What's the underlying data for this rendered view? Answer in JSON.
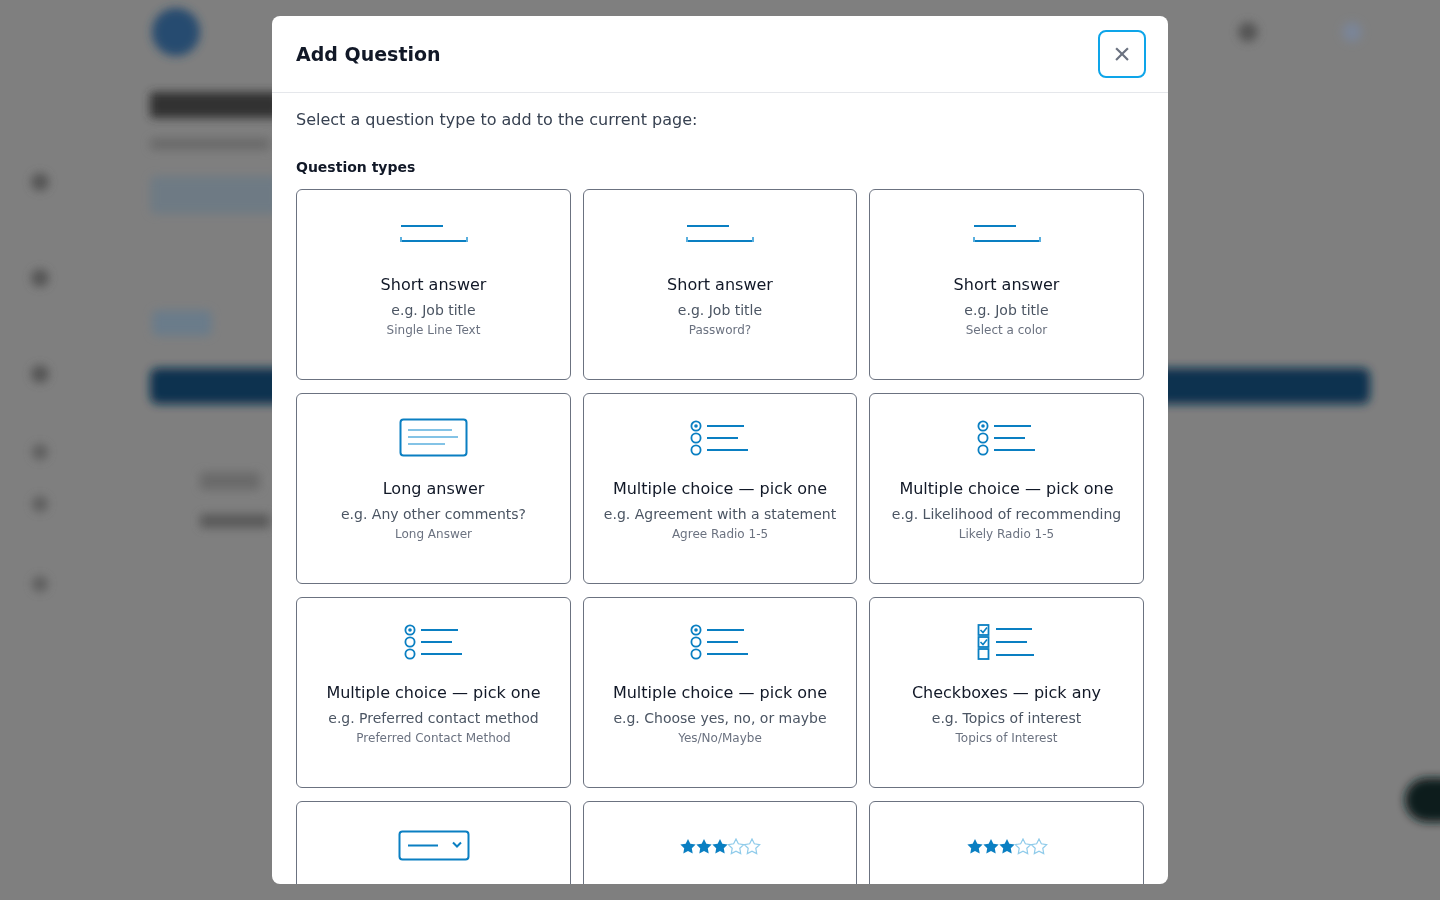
{
  "dialog": {
    "title": "Add Question",
    "close_label": "×",
    "intro": "Select a question type to add to the current page:",
    "section_label": "Question types",
    "question_types": [
      {
        "kind": "short",
        "title": "Short answer",
        "example": "e.g. Job title",
        "subtitle": "Single Line Text"
      },
      {
        "kind": "short",
        "title": "Short answer",
        "example": "e.g. Job title",
        "subtitle": "Password?"
      },
      {
        "kind": "short",
        "title": "Short answer",
        "example": "e.g. Job title",
        "subtitle": "Select a color"
      },
      {
        "kind": "long",
        "title": "Long answer",
        "example": "e.g. Any other comments?",
        "subtitle": "Long Answer"
      },
      {
        "kind": "radio",
        "title": "Multiple choice — pick one",
        "example": "e.g. Agreement with a statement",
        "subtitle": "Agree Radio 1-5"
      },
      {
        "kind": "radio",
        "title": "Multiple choice — pick one",
        "example": "e.g. Likelihood of recommending",
        "subtitle": "Likely Radio 1-5"
      },
      {
        "kind": "radio",
        "title": "Multiple choice — pick one",
        "example": "e.g. Preferred contact method",
        "subtitle": "Preferred Contact Method"
      },
      {
        "kind": "radio",
        "title": "Multiple choice — pick one",
        "example": "e.g. Choose yes, no, or maybe",
        "subtitle": "Yes/No/Maybe"
      },
      {
        "kind": "checkbox",
        "title": "Checkboxes — pick any",
        "example": "e.g. Topics of interest",
        "subtitle": "Topics of Interest"
      },
      {
        "kind": "dropdown"
      },
      {
        "kind": "rating"
      },
      {
        "kind": "rating"
      }
    ]
  }
}
